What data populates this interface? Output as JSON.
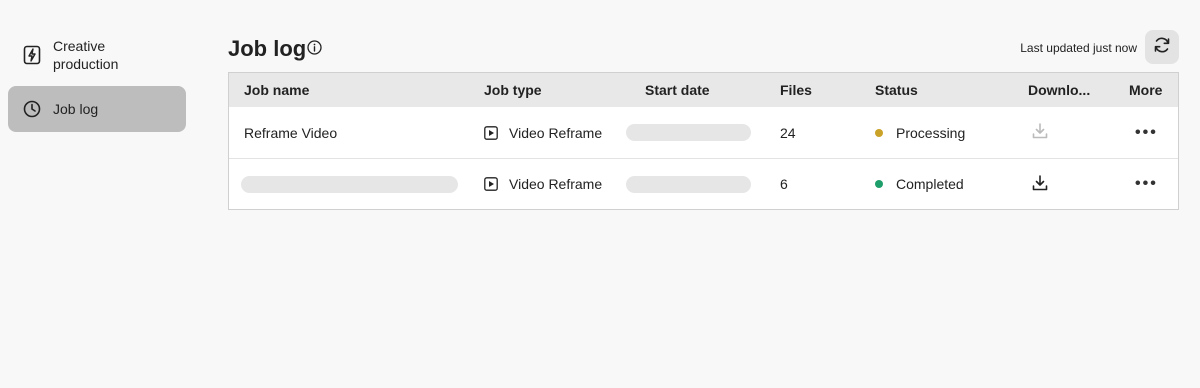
{
  "sidebar": {
    "items": [
      {
        "label": "Creative production",
        "icon": "lightning-document-icon"
      },
      {
        "label": "Job log",
        "icon": "clock-icon"
      }
    ]
  },
  "header": {
    "title": "Job log",
    "last_updated": "Last updated just now"
  },
  "table": {
    "columns": [
      "Job name",
      "Job type",
      "Start date",
      "Files",
      "Status",
      "Downlo...",
      "More"
    ],
    "rows": [
      {
        "name": "Reframe Video",
        "type": "Video Reframe",
        "files": "24",
        "status": "Processing",
        "status_color": "#c9a227",
        "download_enabled": false
      },
      {
        "name": "",
        "type": "Video Reframe",
        "files": "6",
        "status": "Completed",
        "status_color": "#1e9e6a",
        "download_enabled": true
      }
    ]
  },
  "colors": {
    "background": "#f8f8f8",
    "active_nav": "#bdbdbd",
    "header_row": "#e8e8e8"
  }
}
